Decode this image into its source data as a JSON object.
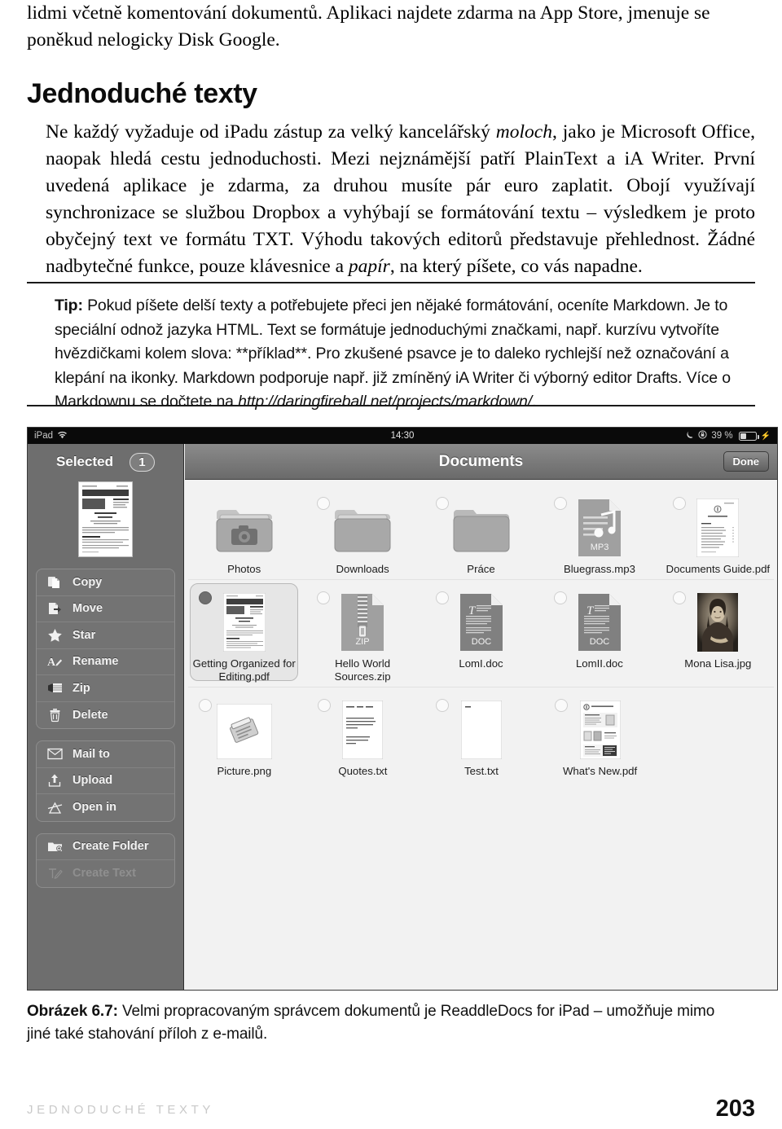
{
  "runover": {
    "line1": "lidmi včetně komentování dokumentů. Aplikaci najdete zdarma na App Store, jmenuje se",
    "line2": "poněkud nelogicky Disk Google."
  },
  "section": {
    "title": "Jednoduché texty",
    "paragraph_part1": "Ne každý vyžaduje od iPadu zástup za velký kancelářský ",
    "paragraph_italic1": "moloch",
    "paragraph_part2": ", jako je Microsoft Office, naopak hledá cestu jednoduchosti. Mezi nejznámější patří PlainText a iA Writer. První uvedená aplikace je zdarma, za druhou musíte pár euro zaplatit. Obojí využívají synchronizace se službou Dropbox a vyhýbají se formátování textu – výsledkem je proto obyčejný text ve formátu TXT. Výhodu takových editorů představuje přehlednost. Žádné nadbytečné funkce, pouze klávesnice a ",
    "paragraph_italic2": "papír",
    "paragraph_part3": ", na který píšete, co vás napadne."
  },
  "tip": {
    "label": "Tip:",
    "text_part1": " Pokud píšete delší texty a potřebujete přeci jen nějaké formátování, oceníte Markdown. Je to speciální odnož jazyka HTML. Text se formátuje jednoduchými značkami, např. kurzívu vytvoříte hvězdičkami kolem slova: **příklad**. Pro zkušené psavce je to daleko rychlejší než označování a klepání na ikonky. Markdown podporuje např. již zmíněný iA Writer či výborný editor Drafts. Více o Markdownu se dočtete na ",
    "url": "http://daringfireball.net/projects/markdown/",
    "text_part2": "."
  },
  "screenshot": {
    "statusbar": {
      "device": "iPad",
      "wifi_icon": "wifi-icon",
      "time": "14:30",
      "moon_icon": "moon-icon",
      "rotation_lock_icon": "rotation-lock-icon",
      "battery_percent": "39 %",
      "battery_icon": "battery-icon"
    },
    "sidebar": {
      "header_label": "Selected",
      "selected_count": "1",
      "thumbnail_name": "selected-document-thumbnail",
      "groups": [
        {
          "items": [
            {
              "label": "Copy",
              "icon": "copy-icon",
              "disabled": false
            },
            {
              "label": "Move",
              "icon": "move-icon",
              "disabled": false
            },
            {
              "label": "Star",
              "icon": "star-icon",
              "disabled": false
            },
            {
              "label": "Rename",
              "icon": "rename-icon",
              "disabled": false
            },
            {
              "label": "Zip",
              "icon": "zip-icon",
              "disabled": false
            },
            {
              "label": "Delete",
              "icon": "trash-icon",
              "disabled": false
            }
          ]
        },
        {
          "items": [
            {
              "label": "Mail to",
              "icon": "mail-icon",
              "disabled": false
            },
            {
              "label": "Upload",
              "icon": "upload-icon",
              "disabled": false
            },
            {
              "label": "Open in",
              "icon": "open-in-icon",
              "disabled": false
            }
          ]
        },
        {
          "items": [
            {
              "label": "Create Folder",
              "icon": "new-folder-icon",
              "disabled": false
            },
            {
              "label": "Create Text",
              "icon": "new-text-icon",
              "disabled": true
            }
          ]
        }
      ]
    },
    "navbar": {
      "title": "Documents",
      "done_label": "Done"
    },
    "grid": {
      "rows": [
        [
          {
            "label": "Photos",
            "kind": "folder-camera",
            "checkbox": "none",
            "selected": false
          },
          {
            "label": "Downloads",
            "kind": "folder",
            "checkbox": "empty",
            "selected": false
          },
          {
            "label": "Práce",
            "kind": "folder",
            "checkbox": "empty",
            "selected": false
          },
          {
            "label": "Bluegrass.mp3",
            "kind": "mp3",
            "badge": "MP3",
            "checkbox": "empty",
            "selected": false
          },
          {
            "label": "Documents Guide.pdf",
            "kind": "pdf-preview",
            "checkbox": "empty",
            "selected": false
          }
        ],
        [
          {
            "label": "Getting Organized for Editing.pdf",
            "kind": "pdf-preview",
            "checkbox": "filled",
            "selected": true
          },
          {
            "label": "Hello World Sources.zip",
            "kind": "zip",
            "badge": "ZIP",
            "checkbox": "empty",
            "selected": false
          },
          {
            "label": "LomI.doc",
            "kind": "doc",
            "badge": "DOC",
            "checkbox": "empty",
            "selected": false
          },
          {
            "label": "LomII.doc",
            "kind": "doc",
            "badge": "DOC",
            "checkbox": "empty",
            "selected": false
          },
          {
            "label": "Mona Lisa.jpg",
            "kind": "image-mona",
            "checkbox": "empty",
            "selected": false
          }
        ],
        [
          {
            "label": "Picture.png",
            "kind": "image-scanner",
            "checkbox": "empty",
            "selected": false
          },
          {
            "label": "Quotes.txt",
            "kind": "txt-quotes",
            "checkbox": "empty",
            "selected": false
          },
          {
            "label": "Test.txt",
            "kind": "txt-plain",
            "checkbox": "empty",
            "selected": false
          },
          {
            "label": "What's New.pdf",
            "kind": "pdf-whatsnew",
            "checkbox": "empty",
            "selected": false
          }
        ]
      ]
    }
  },
  "caption": {
    "label": "Obrázek 6.7:",
    "text": " Velmi propracovaným správcem dokumentů je ReaddleDocs for iPad – umožňuje mimo jiné také stahování příloh z e-mailů."
  },
  "footer": {
    "running_head": "JEDNODUCHÉ TEXTY",
    "page_number": "203"
  },
  "colors": {
    "sidebar_bg": "#6e6e6e",
    "navbar_top": "#8b8b8b",
    "navbar_bottom": "#6a6a6a",
    "content_bg": "#f2f2f2",
    "statusbar_bg": "#0a0a0a",
    "footer_head": "#c9c9c9"
  }
}
